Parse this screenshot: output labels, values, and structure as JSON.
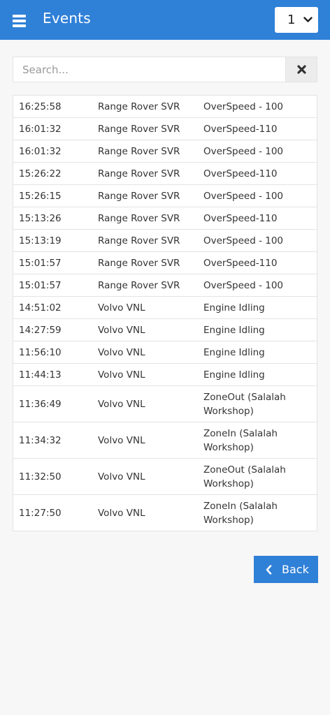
{
  "header": {
    "title": "Events",
    "page_select_value": "1"
  },
  "search": {
    "placeholder": "Search...",
    "value": ""
  },
  "events": [
    {
      "time": "16:25:58",
      "vehicle": "Range Rover SVR",
      "event": "OverSpeed - 100"
    },
    {
      "time": "16:01:32",
      "vehicle": "Range Rover SVR",
      "event": "OverSpeed-110"
    },
    {
      "time": "16:01:32",
      "vehicle": "Range Rover SVR",
      "event": "OverSpeed - 100"
    },
    {
      "time": "15:26:22",
      "vehicle": "Range Rover SVR",
      "event": "OverSpeed-110"
    },
    {
      "time": "15:26:15",
      "vehicle": "Range Rover SVR",
      "event": "OverSpeed - 100"
    },
    {
      "time": "15:13:26",
      "vehicle": "Range Rover SVR",
      "event": "OverSpeed-110"
    },
    {
      "time": "15:13:19",
      "vehicle": "Range Rover SVR",
      "event": "OverSpeed - 100"
    },
    {
      "time": "15:01:57",
      "vehicle": "Range Rover SVR",
      "event": "OverSpeed-110"
    },
    {
      "time": "15:01:57",
      "vehicle": "Range Rover SVR",
      "event": "OverSpeed - 100"
    },
    {
      "time": "14:51:02",
      "vehicle": "Volvo VNL",
      "event": "Engine Idling"
    },
    {
      "time": "14:27:59",
      "vehicle": "Volvo VNL",
      "event": "Engine Idling"
    },
    {
      "time": "11:56:10",
      "vehicle": "Volvo VNL",
      "event": "Engine Idling"
    },
    {
      "time": "11:44:13",
      "vehicle": "Volvo VNL",
      "event": "Engine Idling"
    },
    {
      "time": "11:36:49",
      "vehicle": "Volvo VNL",
      "event": "ZoneOut (Salalah Workshop)"
    },
    {
      "time": "11:34:32",
      "vehicle": "Volvo VNL",
      "event": "ZoneIn (Salalah Workshop)"
    },
    {
      "time": "11:32:50",
      "vehicle": "Volvo VNL",
      "event": "ZoneOut (Salalah Workshop)"
    },
    {
      "time": "11:27:50",
      "vehicle": "Volvo VNL",
      "event": "ZoneIn (Salalah Workshop)"
    }
  ],
  "footer": {
    "back_label": "Back"
  },
  "icons": {
    "menu": "hamburger-icon",
    "select": "chevron-down-icon",
    "clear": "close-icon",
    "back": "chevron-left-icon"
  },
  "colors": {
    "primary": "#2f80d7",
    "background": "#f7f7f7",
    "border": "#e3e3e3"
  }
}
